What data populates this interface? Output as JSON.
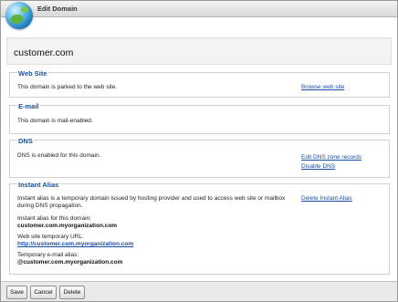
{
  "window": {
    "title": "Edit Domain"
  },
  "domain": {
    "name": "customer.com"
  },
  "web_site": {
    "title": "Web Site",
    "text": "This domain is parked to the web site.",
    "link": "Browse web site"
  },
  "email": {
    "title": "E-mail",
    "text": "This domain is mail-enabled."
  },
  "dns": {
    "title": "DNS",
    "text": "DNS is enabled for this domain.",
    "links": [
      "Edit DNS zone records",
      "Disable DNS"
    ]
  },
  "instant_alias": {
    "title": "Instant Alias",
    "description": "Instant alias is a temporary domain issued by hosting provider and used to access web site or mailbox during DNS propagation.",
    "link": "Delete Instant Alias",
    "alias_label": "Instant alias for this domain:",
    "alias_value": "customer.com.myorganization.com",
    "url_label": "Web site temporary URL:",
    "url_value": "http://customer.com.myorganization.com",
    "email_label": "Temporary e-mail alias:",
    "email_value": "@customer.com.myorganization.com"
  },
  "buttons": {
    "save": "Save",
    "cancel": "Cancel",
    "delete": "Delete"
  },
  "colors": {
    "section_title": "#1a4f8f",
    "link": "#1a4fa8",
    "titlebar": "#e4e4e4"
  }
}
